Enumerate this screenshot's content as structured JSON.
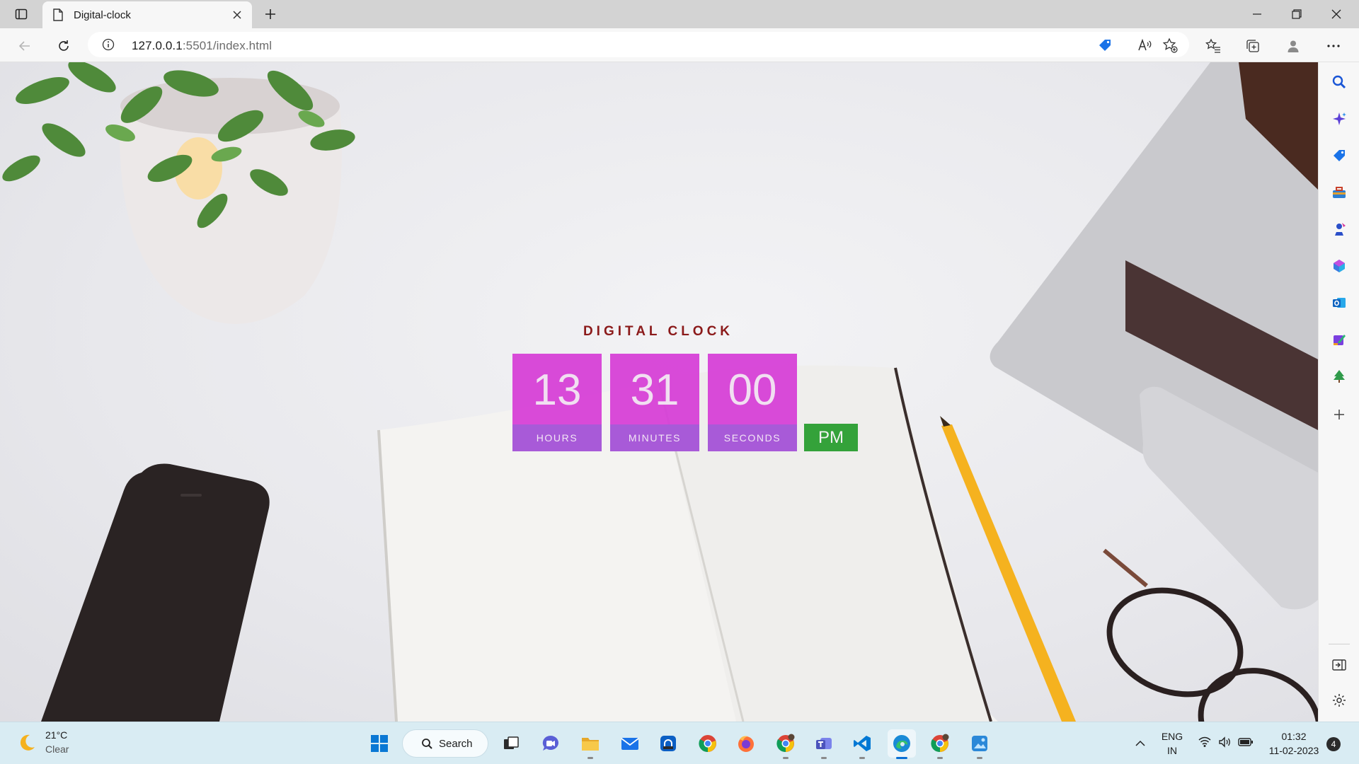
{
  "browser": {
    "tab_title": "Digital-clock",
    "url_host": "127.0.0.1",
    "url_path": ":5501/index.html"
  },
  "clock": {
    "title": "DIGITAL CLOCK",
    "hours": "13",
    "minutes": "31",
    "seconds": "00",
    "hours_label": "HOURS",
    "minutes_label": "MINUTES",
    "seconds_label": "SECONDS",
    "period": "PM",
    "colors": {
      "box": "#d63cd6",
      "label_bar": "#a85ad8",
      "period_bg": "#34a23a",
      "title": "#8b1a1a"
    }
  },
  "sidebar": {
    "icons": [
      "search-icon",
      "copilot-icon",
      "shopping-tag-icon",
      "tools-icon",
      "games-icon",
      "microsoft365-icon",
      "outlook-icon",
      "designer-icon",
      "tree-icon",
      "add-icon",
      "split-screen-icon",
      "settings-icon"
    ]
  },
  "taskbar": {
    "weather_temp": "21°C",
    "weather_cond": "Clear",
    "search_label": "Search",
    "lang_line1": "ENG",
    "lang_line2": "IN",
    "time": "01:32",
    "date": "11-02-2023",
    "notification_count": "4"
  }
}
